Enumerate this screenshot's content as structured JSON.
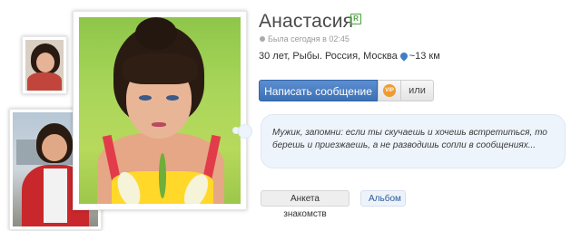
{
  "profile": {
    "name": "Анастасия",
    "badge": "R",
    "status": "Была сегодня в 02:45",
    "details_prefix": "30 лет, Рыбы. Россия, Москва",
    "distance": "~13 км",
    "quote": "Мужик, запомни: если ты скучаешь и хочешь встретиться, то берешь и приезжаешь, а не разводишь сопли в сообщениях..."
  },
  "actions": {
    "message_label": "Написать сообщение",
    "vip_label": "VIP",
    "or_label": "или"
  },
  "tabs": [
    {
      "label": "Анкета знакомств"
    },
    {
      "label": "Альбом"
    }
  ],
  "colors": {
    "primary_button": "#3b70b6",
    "badge_green": "#4aa53d",
    "bubble_bg": "#eef4fb",
    "location_pin": "#3f7fc7",
    "vip_orange": "#f19a2d"
  }
}
